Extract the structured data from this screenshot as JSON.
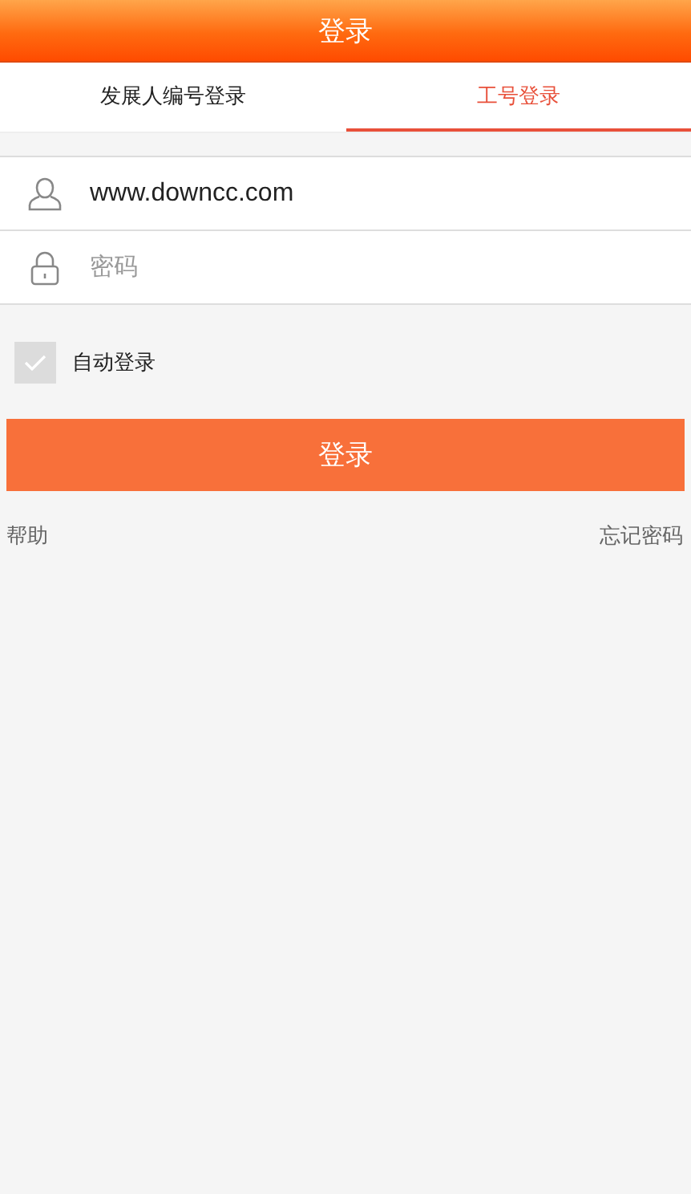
{
  "header": {
    "title": "登录"
  },
  "tabs": [
    {
      "label": "发展人编号登录",
      "selected": false
    },
    {
      "label": "工号登录",
      "selected": true
    }
  ],
  "fields": [
    {
      "kind": "user",
      "value": "www.downcc.com"
    },
    {
      "kind": "lock",
      "placeholder": "密码"
    }
  ],
  "auto_login": {
    "label": "自动登录",
    "checked": true
  },
  "login_button": "登录",
  "links": [
    "帮助",
    "忘记密码"
  ]
}
